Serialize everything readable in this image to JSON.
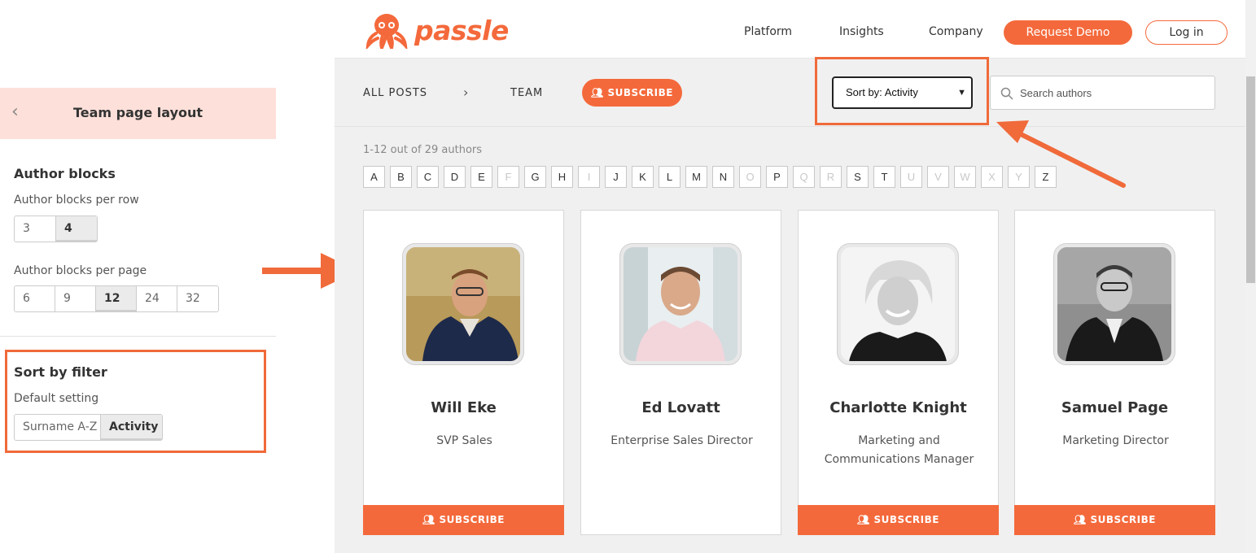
{
  "panel": {
    "title": "Team page layout",
    "back_icon": "chevron-left-icon",
    "author_blocks": {
      "title": "Author blocks",
      "per_row_label": "Author blocks per row",
      "per_row_options": [
        "3",
        "4"
      ],
      "per_row_selected": "4",
      "per_page_label": "Author blocks per page",
      "per_page_options": [
        "6",
        "9",
        "12",
        "24",
        "32"
      ],
      "per_page_selected": "12"
    },
    "sort": {
      "title": "Sort by filter",
      "default_label": "Default setting",
      "options": [
        "Surname A-Z",
        "Activity"
      ],
      "selected": "Activity"
    }
  },
  "site": {
    "logo_text": "passle",
    "nav": [
      "Platform",
      "Insights",
      "Company"
    ],
    "request_demo": "Request Demo",
    "login": "Log in",
    "breadcrumb": {
      "all_posts": "ALL POSTS",
      "team": "TEAM"
    },
    "subscribe": "SUBSCRIBE",
    "sort_select_value": "Sort by: Activity",
    "search_placeholder": "Search authors",
    "count_text": "1-12 out of 29 authors",
    "alphabet": [
      {
        "l": "A",
        "on": true
      },
      {
        "l": "B",
        "on": true
      },
      {
        "l": "C",
        "on": true
      },
      {
        "l": "D",
        "on": true
      },
      {
        "l": "E",
        "on": true
      },
      {
        "l": "F",
        "on": false
      },
      {
        "l": "G",
        "on": true
      },
      {
        "l": "H",
        "on": true
      },
      {
        "l": "I",
        "on": false
      },
      {
        "l": "J",
        "on": true
      },
      {
        "l": "K",
        "on": true
      },
      {
        "l": "L",
        "on": true
      },
      {
        "l": "M",
        "on": true
      },
      {
        "l": "N",
        "on": true
      },
      {
        "l": "O",
        "on": false
      },
      {
        "l": "P",
        "on": true
      },
      {
        "l": "Q",
        "on": false
      },
      {
        "l": "R",
        "on": false
      },
      {
        "l": "S",
        "on": true
      },
      {
        "l": "T",
        "on": true
      },
      {
        "l": "U",
        "on": false
      },
      {
        "l": "V",
        "on": false
      },
      {
        "l": "W",
        "on": false
      },
      {
        "l": "X",
        "on": false
      },
      {
        "l": "Y",
        "on": false
      },
      {
        "l": "Z",
        "on": true
      }
    ],
    "authors": [
      {
        "name": "Will Eke",
        "role": "SVP Sales",
        "subscribe": true
      },
      {
        "name": "Ed Lovatt",
        "role": "Enterprise Sales Director",
        "subscribe": false
      },
      {
        "name": "Charlotte Knight",
        "role": "Marketing and Communications Manager",
        "subscribe": true
      },
      {
        "name": "Samuel Page",
        "role": "Marketing Director",
        "subscribe": true
      }
    ],
    "card_subscribe": "SUBSCRIBE"
  },
  "colors": {
    "brand": "#f4693b",
    "annotation": "#f06a3a",
    "panel_header": "#fde0d9"
  }
}
